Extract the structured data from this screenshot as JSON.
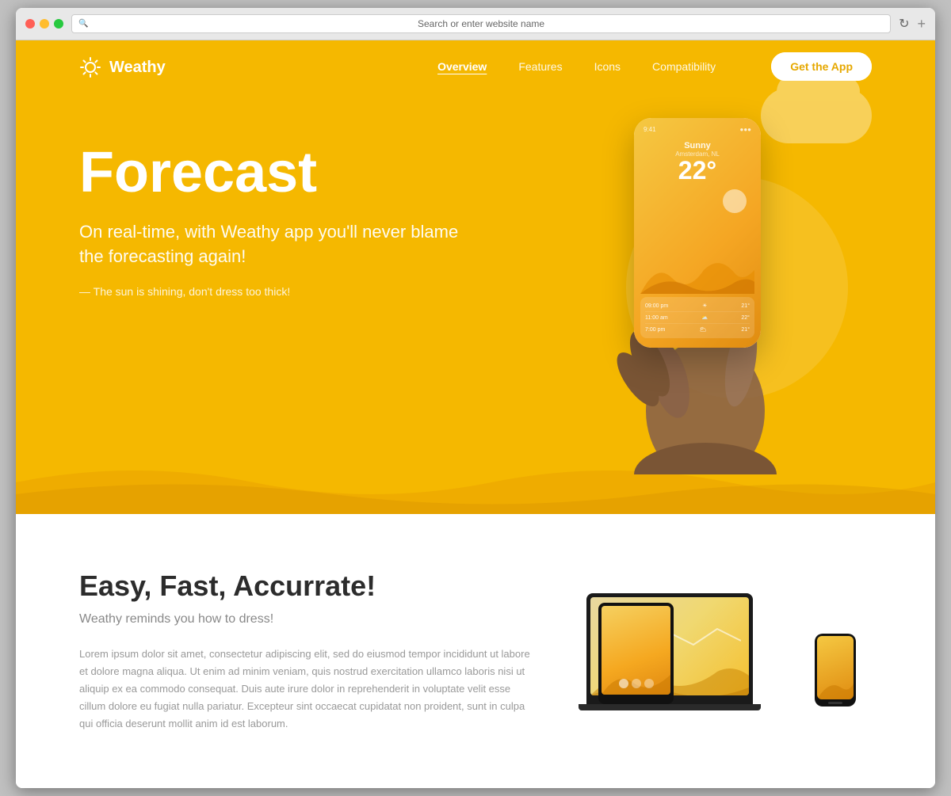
{
  "browser": {
    "address_bar_placeholder": "Search or enter website name",
    "new_tab_label": "+"
  },
  "nav": {
    "logo_text": "Weathy",
    "links": [
      {
        "label": "Overview",
        "active": true
      },
      {
        "label": "Features",
        "active": false
      },
      {
        "label": "Icons",
        "active": false
      },
      {
        "label": "Compatibility",
        "active": false
      }
    ],
    "cta_label": "Get the App"
  },
  "hero": {
    "title": "Forecast",
    "subtitle": "On real-time, with Weathy app you'll never blame the forecasting again!",
    "quote": "— The sun is shining, don't dress too thick!",
    "phone_weather_label": "Sunny",
    "phone_weather_sub": "Amsterdam, NL",
    "phone_temp": "22°",
    "phone_rows": [
      {
        "time": "09:00 pm",
        "icon": "☀",
        "temp": "21°"
      },
      {
        "time": "11:00 am",
        "icon": "⛅",
        "temp": "22°"
      },
      {
        "time": "7:00 pm",
        "icon": "🌥",
        "temp": "21°"
      }
    ]
  },
  "features": {
    "title": "Easy, Fast, Accurrate!",
    "subtitle": "Weathy reminds you how to dress!",
    "body": "Lorem ipsum dolor sit amet, consectetur adipiscing elit, sed do eiusmod tempor incididunt ut labore et dolore magna aliqua. Ut enim ad minim veniam, quis nostrud exercitation ullamco laboris nisi ut aliquip ex ea commodo consequat. Duis aute irure dolor in reprehenderit in voluptate velit esse cillum dolore eu fugiat nulla pariatur. Excepteur sint occaecat cupidatat non proident, sunt in culpa qui officia deserunt mollit anim id est laborum."
  },
  "colors": {
    "hero_bg": "#f5b800",
    "hero_wave": "#f0a800",
    "white": "#ffffff",
    "dark_text": "#2c2c2c",
    "gray_text": "#888888",
    "light_gray": "#999999"
  }
}
